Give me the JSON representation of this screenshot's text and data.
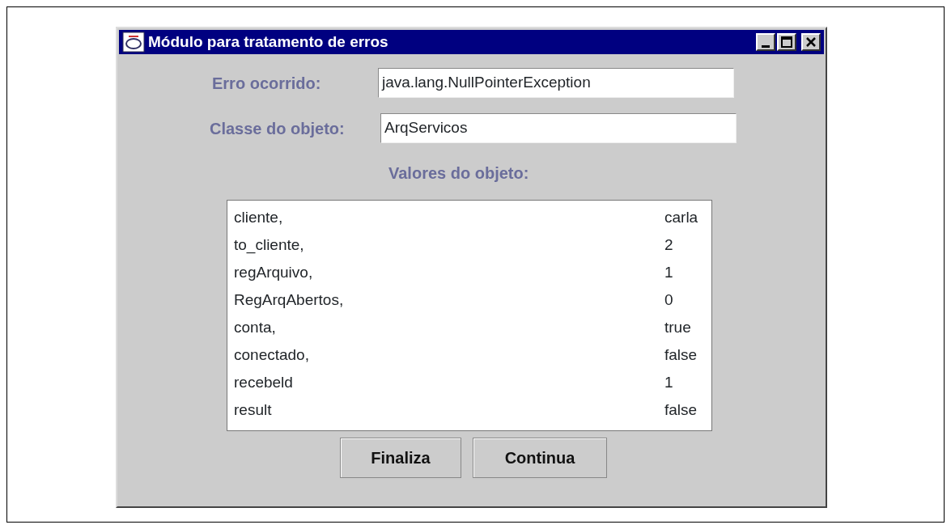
{
  "window": {
    "title": "Módulo para tratamento de erros"
  },
  "fields": [
    {
      "label": "Erro ocorrido:",
      "value": "java.lang.NullPointerException"
    },
    {
      "label": "Classe do objeto:",
      "value": "ArqServicos"
    }
  ],
  "values_label": "Valores do objeto:",
  "values_list": [
    {
      "name": "cliente,",
      "value": "carla"
    },
    {
      "name": "to_cliente,",
      "value": "2"
    },
    {
      "name": "regArquivo,",
      "value": "1"
    },
    {
      "name": "RegArqAbertos,",
      "value": "0"
    },
    {
      "name": "conta,",
      "value": "true"
    },
    {
      "name": "conectado,",
      "value": "false"
    },
    {
      "name": "recebeld",
      "value": "1"
    },
    {
      "name": "result",
      "value": "false"
    }
  ],
  "buttons": [
    "Finaliza",
    "Continua"
  ]
}
